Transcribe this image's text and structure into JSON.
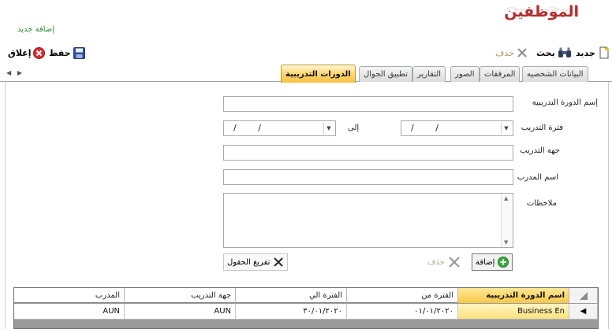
{
  "header": {
    "title": "الموظفين",
    "add_new_link": "إضافة جديد"
  },
  "toolbar": {
    "new_label": "جديد",
    "search_label": "بحث",
    "delete_label": "حذف",
    "save_label": "حفظ",
    "close_label": "إغلاق"
  },
  "tabs": [
    {
      "label": "البيانات الشخصيه"
    },
    {
      "label": "المرفقات"
    },
    {
      "label": "الصور"
    },
    {
      "label": "التقارير"
    },
    {
      "label": "تطبيق الجوال"
    },
    {
      "label": "الدورات التدريبية"
    }
  ],
  "form": {
    "course_name_label": "إسم الدورة التدريبية",
    "training_period_label": "فترة التدريب",
    "to_label": "إلى",
    "date_placeholder": "/   /",
    "training_entity_label": "جهة التدريب",
    "trainer_name_label": "اسم المدرب",
    "notes_label": "ملاحظات"
  },
  "actions": {
    "add_label": "إضافة",
    "delete_label": "حذف",
    "clear_label": "تفريغ الحقول"
  },
  "grid": {
    "columns": [
      "اسم الدورة التدريبية",
      "الفترة من",
      "الفترة الي",
      "جهة التدريب",
      "المدرب"
    ],
    "rows": [
      [
        "Business En",
        "٠١/٠١/٢٠٢٠",
        "٣٠/٠١/٢٠٢٠",
        "AUN",
        "AUN"
      ]
    ]
  },
  "colors": {
    "title_red": "#b03030",
    "link_green": "#2f8a2f",
    "active_tab_gold": "#f8c143"
  }
}
